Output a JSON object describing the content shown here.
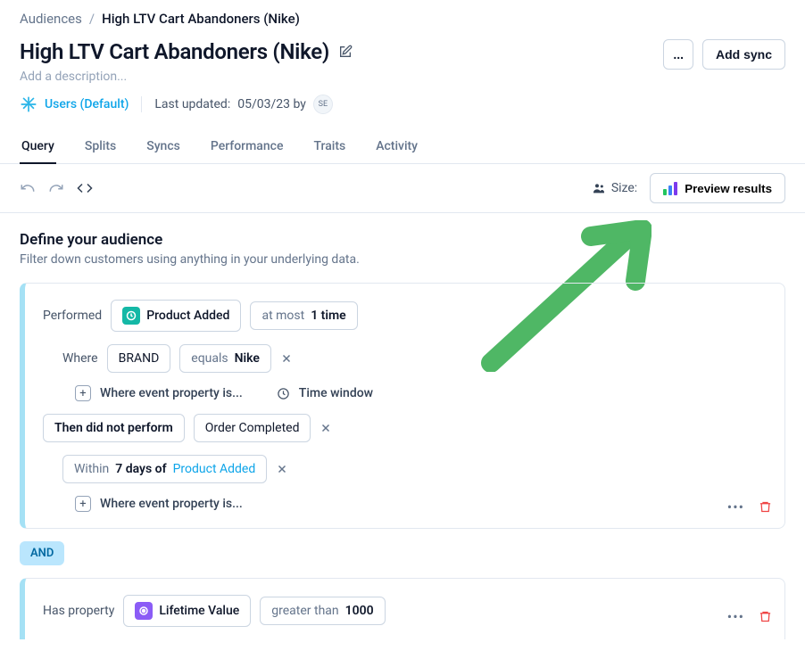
{
  "breadcrumb": {
    "parent": "Audiences",
    "current": "High LTV Cart Abandoners (Nike)"
  },
  "header": {
    "title": "High LTV Cart Abandoners (Nike)",
    "description_placeholder": "Add a description...",
    "more_label": "...",
    "add_sync": "Add sync"
  },
  "datasource": {
    "label": "Users (Default)"
  },
  "updated": {
    "prefix": "Last updated:",
    "date": "05/03/23 by",
    "initials": "SE"
  },
  "tabs": [
    "Query",
    "Splits",
    "Syncs",
    "Performance",
    "Traits",
    "Activity"
  ],
  "active_tab": 0,
  "toolbar": {
    "size_label": "Size:",
    "preview_label": "Preview results"
  },
  "section": {
    "title": "Define your audience",
    "subtitle": "Filter down customers using anything in your underlying data."
  },
  "block1": {
    "performed": "Performed",
    "event": "Product Added",
    "freq_prefix": "at most ",
    "freq_value": "1 time",
    "where": "Where",
    "prop": "BRAND",
    "op_prefix": "equals ",
    "op_value": "Nike",
    "add_prop": "Where event property is...",
    "time_window": "Time window",
    "then": "Then did not perform",
    "event2": "Order Completed",
    "within_prefix": "Within ",
    "within_value": "7 days of ",
    "within_ref": "Product Added",
    "add_prop2": "Where event property is..."
  },
  "connector": "AND",
  "block2": {
    "has_prop": "Has property",
    "prop": "Lifetime Value",
    "op_prefix": "greater than ",
    "op_value": "1000"
  }
}
